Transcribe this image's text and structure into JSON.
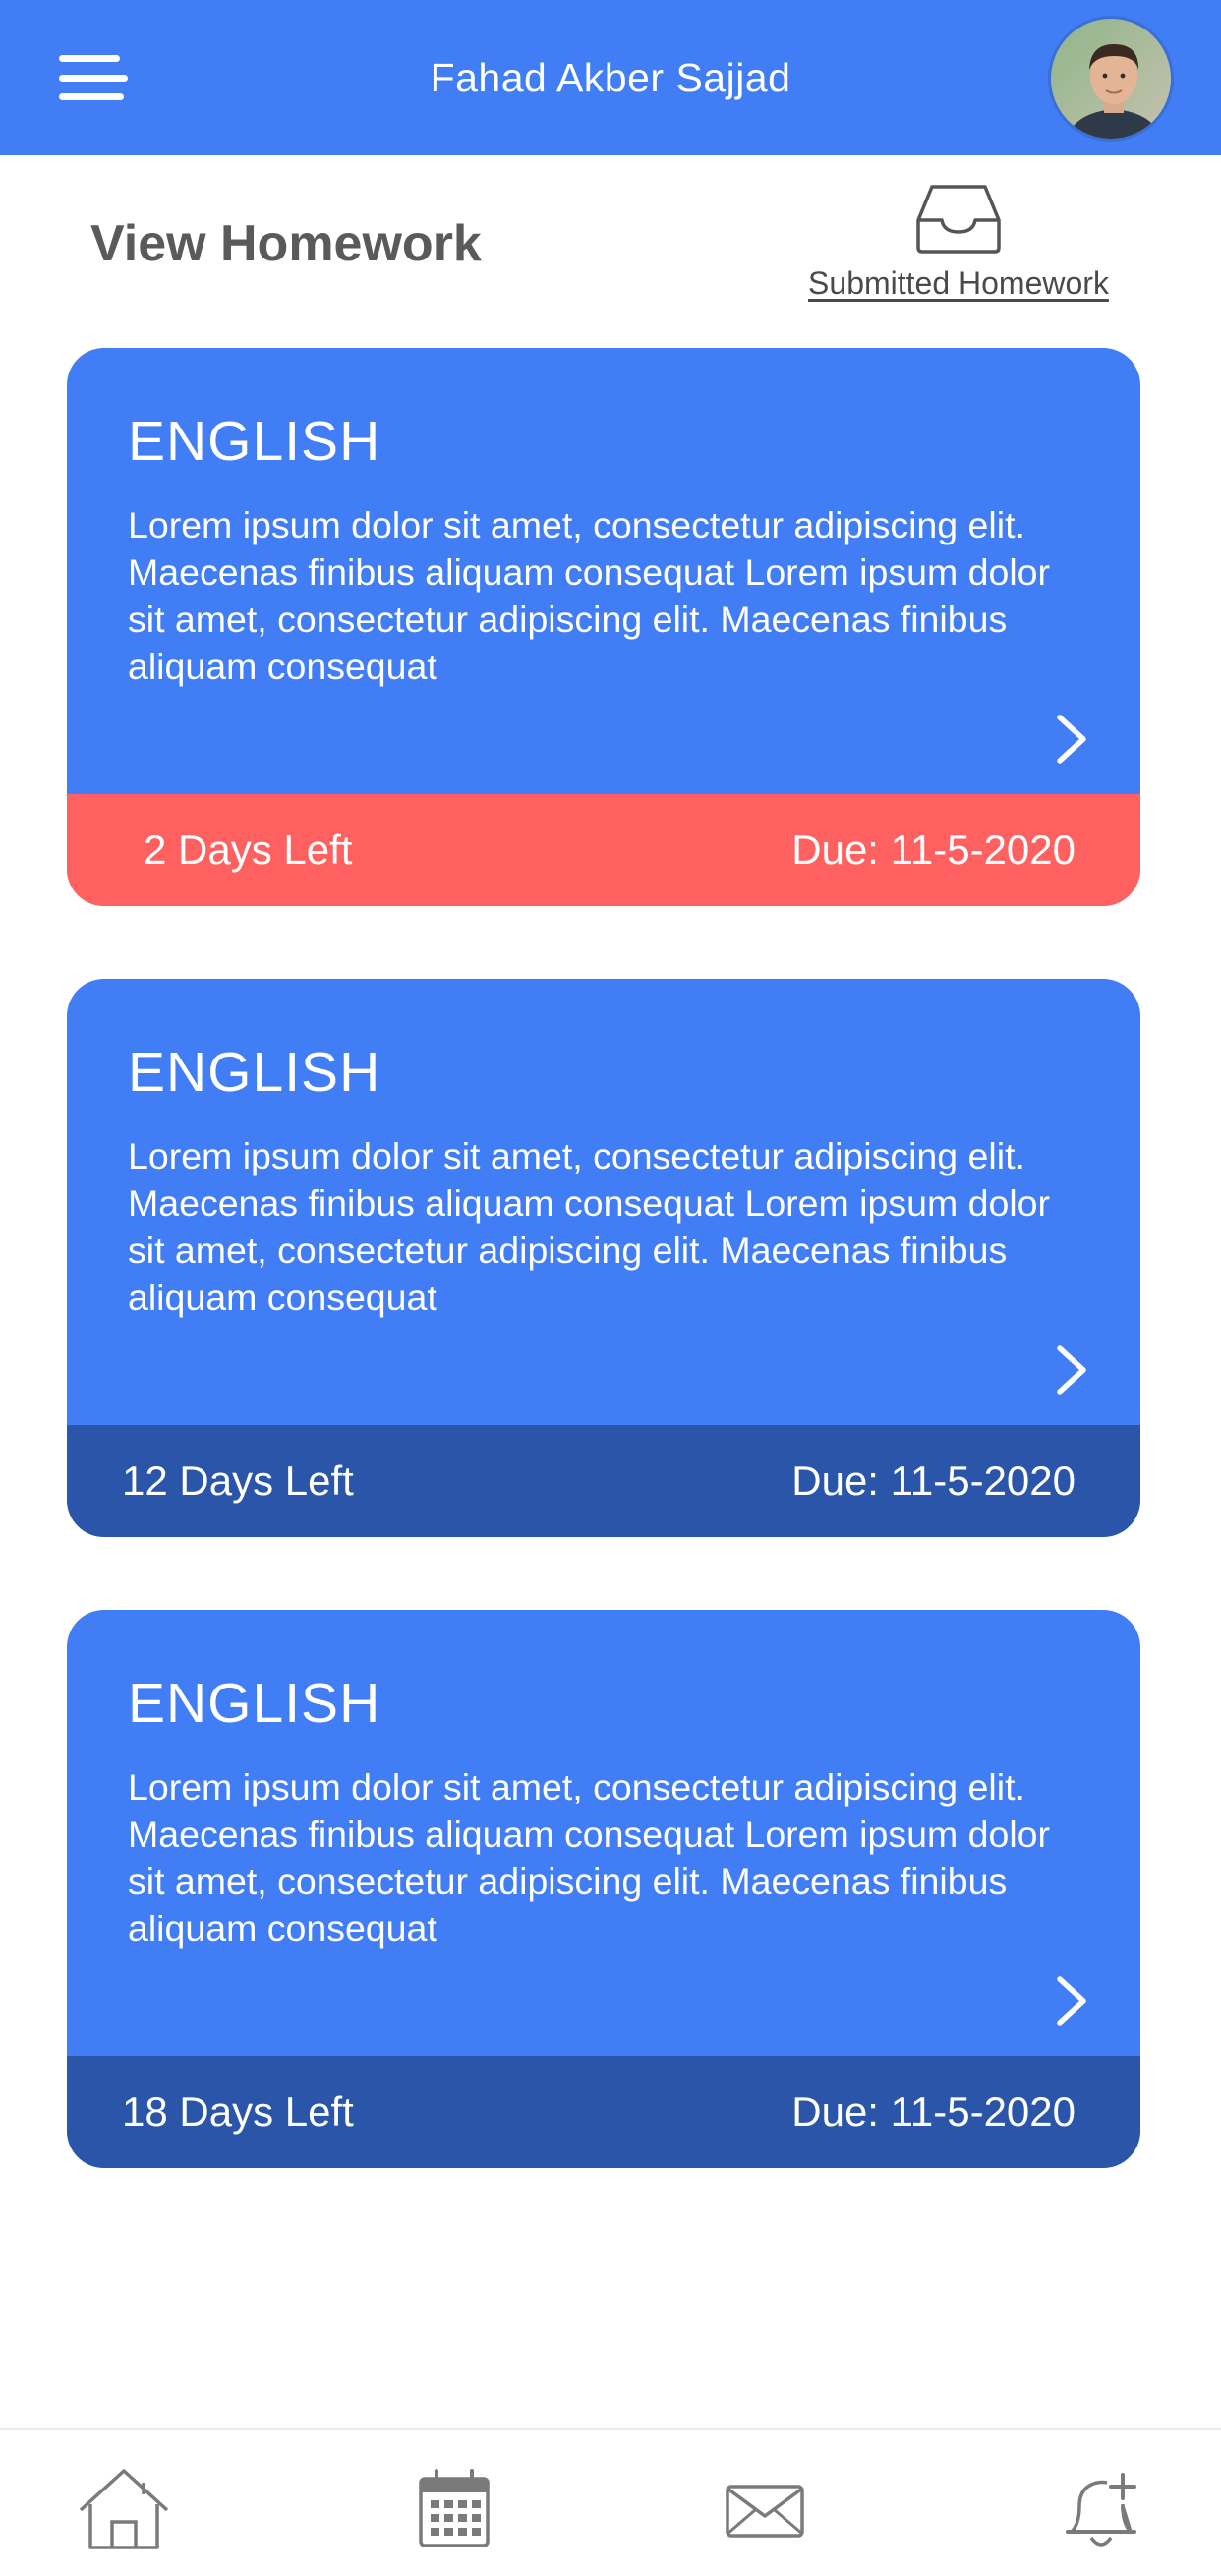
{
  "header": {
    "title": "Fahad Akber Sajjad",
    "menu_icon": "hamburger-menu-icon",
    "avatar": "user-avatar-photo",
    "color": "#417df5"
  },
  "page": {
    "title": "View Homework",
    "submitted_label": "Submitted Homework",
    "submitted_icon": "inbox-tray-icon"
  },
  "homework": [
    {
      "subject": "ENGLISH",
      "description": "Lorem ipsum dolor sit amet, consectetur adipiscing elit. Maecenas finibus aliquam consequat Lorem ipsum dolor sit amet, consectetur adipiscing elit. Maecenas finibus aliquam consequat",
      "days_left": "2 Days Left",
      "due": "Due: 11-5-2020",
      "status_color": "#ff6160"
    },
    {
      "subject": "ENGLISH",
      "description": "Lorem ipsum dolor sit amet, consectetur adipiscing elit. Maecenas finibus aliquam consequat Lorem ipsum dolor sit amet, consectetur adipiscing elit. Maecenas finibus aliquam consequat",
      "days_left": "12 Days Left",
      "due": "Due: 11-5-2020",
      "status_color": "#2a55a8"
    },
    {
      "subject": "ENGLISH",
      "description": "Lorem ipsum dolor sit amet, consectetur adipiscing elit. Maecenas finibus aliquam consequat Lorem ipsum dolor sit amet, consectetur adipiscing elit. Maecenas finibus aliquam consequat",
      "days_left": "18 Days Left",
      "due": "Due: 11-5-2020",
      "status_color": "#2a55a8"
    }
  ],
  "bottom_nav": {
    "items": [
      "home-icon",
      "calendar-icon",
      "mail-icon",
      "bell-add-icon"
    ]
  }
}
